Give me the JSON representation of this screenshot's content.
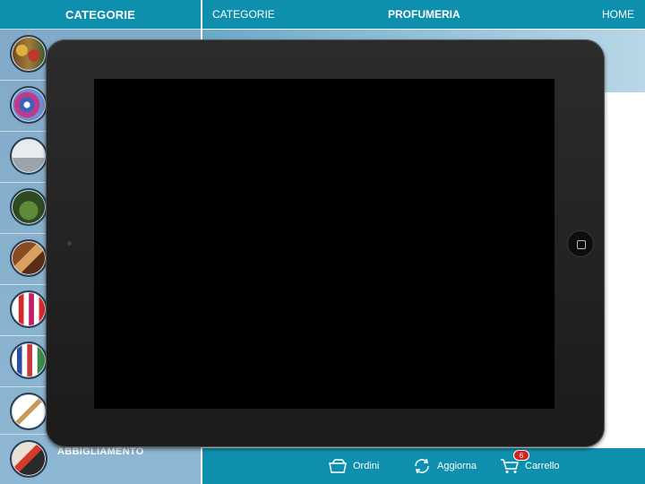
{
  "sidebar": {
    "header": "CATEGORIE",
    "items": [
      {
        "label": "",
        "icon": "perfume-bottles-thumbnail"
      },
      {
        "label": "",
        "icon": "cosmetics-thumbnail"
      },
      {
        "label": "",
        "icon": "household-thumbnail"
      },
      {
        "label": "",
        "icon": "garden-thumbnail"
      },
      {
        "label": "",
        "icon": "food-thumbnail"
      },
      {
        "label": "",
        "icon": "bottles-thumbnail"
      },
      {
        "label": "",
        "icon": "products-thumbnail"
      },
      {
        "label": "",
        "icon": "glasses-thumbnail"
      },
      {
        "label": "ABBIGLIAMENTO",
        "icon": "clothing-thumbnail"
      }
    ]
  },
  "topbar": {
    "categorie": "CATEGORIE",
    "title": "PROFUMERIA",
    "home": "HOME"
  },
  "bottombar": {
    "ordini": "Ordini",
    "aggiorna": "Aggiorna",
    "carrello": "Carrello",
    "cart_count": "6"
  },
  "colors": {
    "accent": "#0e8fae",
    "sidebar": "#86b0cc",
    "badge": "#d3231c"
  }
}
